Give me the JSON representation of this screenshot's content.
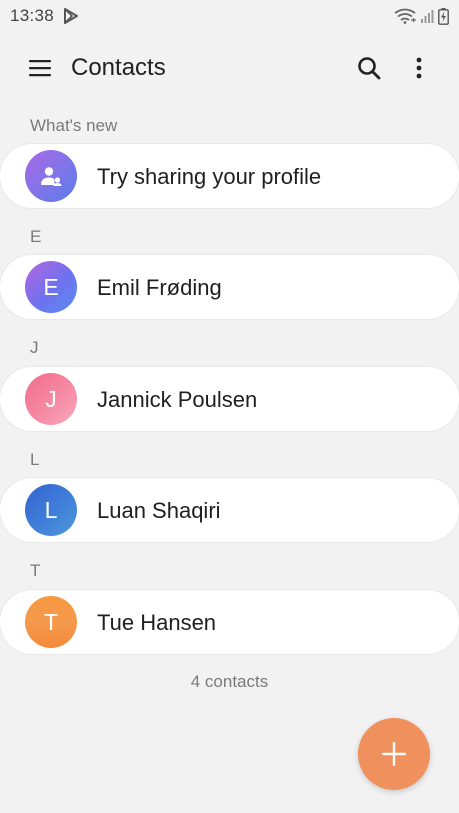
{
  "status_bar": {
    "time": "13:38",
    "notification_icon": "play-store-icon",
    "wifi_icon": "wifi-icon",
    "signal_icon": "cell-signal-icon",
    "battery_icon": "battery-charging-icon"
  },
  "app_bar": {
    "menu_icon": "hamburger-menu-icon",
    "title": "Contacts",
    "search_icon": "search-icon",
    "more_icon": "more-vert-icon"
  },
  "whats_new": {
    "header": "What's new",
    "item_label": "Try sharing your profile",
    "item_icon": "share-profile-icon"
  },
  "groups": [
    {
      "letter": "E",
      "contacts": [
        {
          "initial": "E",
          "name": "Emil Frøding",
          "color": "#7a6cf0",
          "color2": "#6f8bf3"
        }
      ]
    },
    {
      "letter": "J",
      "contacts": [
        {
          "initial": "J",
          "name": "Jannick Poulsen",
          "color": "#f27b98",
          "color2": "#f79ab0"
        }
      ]
    },
    {
      "letter": "L",
      "contacts": [
        {
          "initial": "L",
          "name": "Luan Shaqiri",
          "color": "#3e73d8",
          "color2": "#4a8ad9"
        }
      ]
    },
    {
      "letter": "T",
      "contacts": [
        {
          "initial": "T",
          "name": "Tue Hansen",
          "color": "#f59040",
          "color2": "#f7a05a"
        }
      ]
    }
  ],
  "contact_count": "4 contacts",
  "fab": {
    "icon": "plus-icon",
    "color": "#f0905c"
  },
  "colors": {
    "background": "#f2f2f2",
    "card": "#ffffff",
    "secondary_text": "#7a7a7a",
    "accent": "#f0905c"
  }
}
